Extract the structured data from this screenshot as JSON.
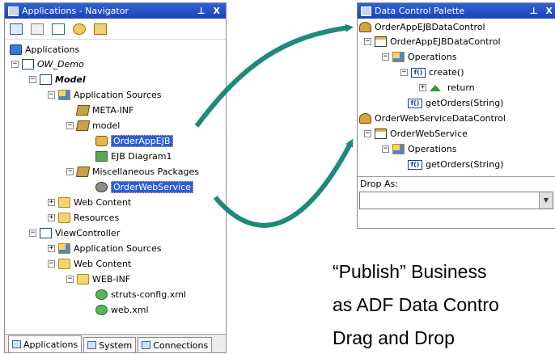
{
  "navigator": {
    "title": "Applications - Navigator",
    "title_buttons": "⊥ X",
    "tree": [
      {
        "label": "Applications",
        "icon": "applications-icon"
      },
      {
        "label": "OW_Demo",
        "icon": "workspace-icon"
      },
      {
        "label": "Model",
        "icon": "project-icon"
      },
      {
        "label": "Application Sources",
        "icon": "application-sources-icon"
      },
      {
        "label": "META-INF",
        "icon": "package-icon"
      },
      {
        "label": "model",
        "icon": "package-icon"
      },
      {
        "label": "OrderAppEJB",
        "icon": "ejb-icon"
      },
      {
        "label": "EJB Diagram1",
        "icon": "diagram-icon"
      },
      {
        "label": "Miscellaneous Packages",
        "icon": "package-icon"
      },
      {
        "label": "OrderWebService",
        "icon": "web-service-icon"
      },
      {
        "label": "Web Content",
        "icon": "folder-icon"
      },
      {
        "label": "Resources",
        "icon": "folder-icon"
      },
      {
        "label": "ViewController",
        "icon": "project-icon"
      },
      {
        "label": "Application Sources",
        "icon": "application-sources-icon"
      },
      {
        "label": "Web Content",
        "icon": "folder-icon"
      },
      {
        "label": "WEB-INF",
        "icon": "folder-icon"
      },
      {
        "label": "struts-config.xml",
        "icon": "xml-file-icon"
      },
      {
        "label": "web.xml",
        "icon": "xml-file-icon"
      }
    ],
    "tabs": [
      "Applications",
      "System",
      "Connections"
    ]
  },
  "palette": {
    "title": "Data Control Palette",
    "title_buttons": "⊥ X",
    "tree": [
      {
        "label": "OrderAppEJBDataControl",
        "icon": "data-control-icon"
      },
      {
        "label": "OrderAppEJBDataControl",
        "icon": "collection-icon"
      },
      {
        "label": "Operations",
        "icon": "operations-folder-icon"
      },
      {
        "label": "create()",
        "icon": "function-icon",
        "badge": "f()"
      },
      {
        "label": "return",
        "icon": "return-icon"
      },
      {
        "label": "getOrders(String)",
        "icon": "function-icon",
        "badge": "f()"
      },
      {
        "label": "OrderWebServiceDataControl",
        "icon": "data-control-icon"
      },
      {
        "label": "OrderWebService",
        "icon": "collection-icon"
      },
      {
        "label": "Operations",
        "icon": "operations-folder-icon"
      },
      {
        "label": "getOrders(String)",
        "icon": "function-icon",
        "badge": "f()"
      }
    ],
    "drop_as_label": "Drop As:",
    "drop_as_value": ""
  },
  "caption": {
    "line1": "“Publish” Business",
    "line2": "as ADF Data Contro",
    "line3": "Drag and Drop"
  },
  "colors": {
    "arrow": "#1d8a7a",
    "titlebar": "#2a57c9",
    "selection": "#2d5fd2"
  }
}
